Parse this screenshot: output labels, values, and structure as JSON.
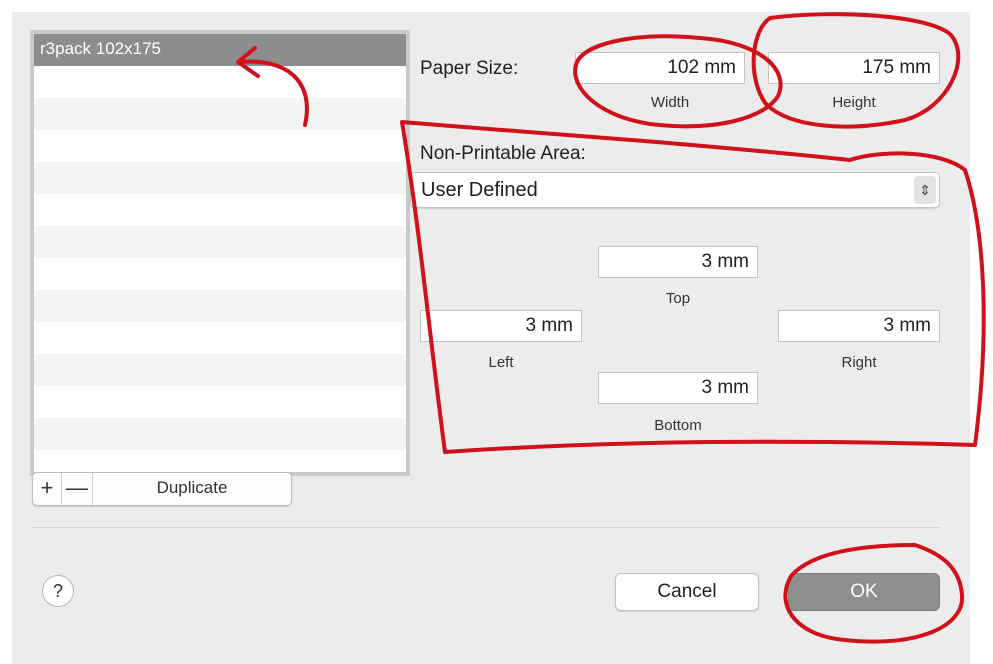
{
  "list": {
    "items": [
      "r3pack 102x175"
    ],
    "selected_index": 0
  },
  "list_controls": {
    "add_label": "+",
    "remove_label": "—",
    "duplicate_label": "Duplicate"
  },
  "paper_size": {
    "label": "Paper Size:",
    "width_value": "102 mm",
    "width_caption": "Width",
    "height_value": "175 mm",
    "height_caption": "Height"
  },
  "non_printable": {
    "label": "Non-Printable Area:",
    "mode_value": "User Defined",
    "mode_icon": "up-down-chevron-icon",
    "top_value": "3 mm",
    "top_caption": "Top",
    "left_value": "3 mm",
    "left_caption": "Left",
    "right_value": "3 mm",
    "right_caption": "Right",
    "bottom_value": "3 mm",
    "bottom_caption": "Bottom"
  },
  "footer": {
    "help_label": "?",
    "cancel_label": "Cancel",
    "ok_label": "OK"
  },
  "colors": {
    "dialog_bg": "#ececec",
    "selected_row": "#8d8d8d",
    "annotation_red": "#d0101a",
    "default_button": "#8f8f8f"
  }
}
